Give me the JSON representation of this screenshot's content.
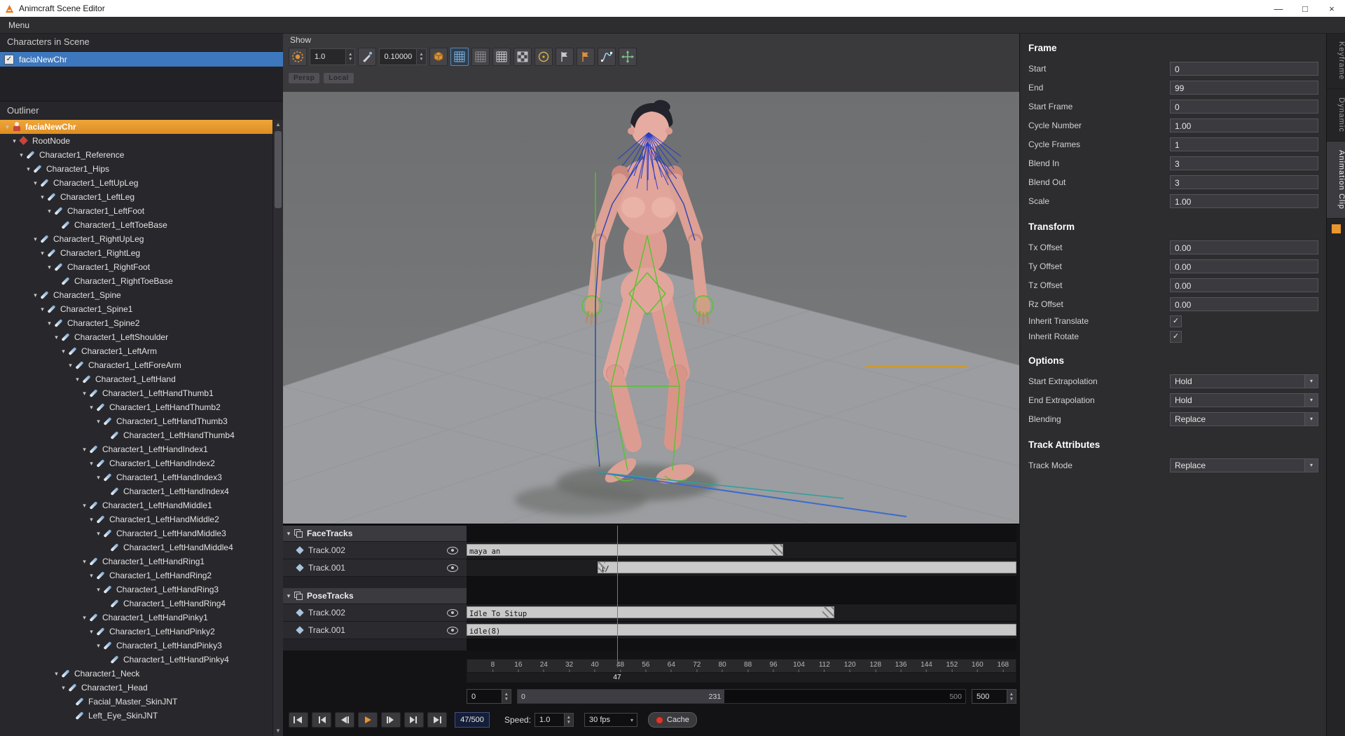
{
  "window": {
    "title": "Animcraft Scene Editor",
    "menu_label": "Menu"
  },
  "icons": {
    "caret_down": "▾",
    "spin_up": "▲",
    "spin_down": "▼",
    "check": "✓",
    "minimize": "—",
    "maximize": "□",
    "close": "×"
  },
  "colors": {
    "accent_orange": "#e8962e",
    "selection_blue": "#3d77bd",
    "selection_orange": "#f0a63a",
    "clip_fill": "#c9c9c9",
    "playhead_blue": "#5b79d8",
    "skin": "#e2a59b"
  },
  "left_panel": {
    "characters_header": "Characters in Scene",
    "characters": [
      {
        "label": "faciaNewChr",
        "checked": true
      }
    ],
    "outliner_header": "Outliner",
    "tree": [
      {
        "label": "faciaNewChr",
        "level": 0,
        "selected": true,
        "icon": "character"
      },
      {
        "label": "RootNode",
        "level": 1,
        "icon": "root"
      },
      {
        "label": "Character1_Reference",
        "level": 2
      },
      {
        "label": "Character1_Hips",
        "level": 3
      },
      {
        "label": "Character1_LeftUpLeg",
        "level": 4
      },
      {
        "label": "Character1_LeftLeg",
        "level": 5
      },
      {
        "label": "Character1_LeftFoot",
        "level": 6
      },
      {
        "label": "Character1_LeftToeBase",
        "level": 7,
        "leaf": true
      },
      {
        "label": "Character1_RightUpLeg",
        "level": 4
      },
      {
        "label": "Character1_RightLeg",
        "level": 5
      },
      {
        "label": "Character1_RightFoot",
        "level": 6
      },
      {
        "label": "Character1_RightToeBase",
        "level": 7,
        "leaf": true
      },
      {
        "label": "Character1_Spine",
        "level": 4
      },
      {
        "label": "Character1_Spine1",
        "level": 5
      },
      {
        "label": "Character1_Spine2",
        "level": 6
      },
      {
        "label": "Character1_LeftShoulder",
        "level": 7
      },
      {
        "label": "Character1_LeftArm",
        "level": 8
      },
      {
        "label": "Character1_LeftForeArm",
        "level": 9
      },
      {
        "label": "Character1_LeftHand",
        "level": 10
      },
      {
        "label": "Character1_LeftHandThumb1",
        "level": 11
      },
      {
        "label": "Character1_LeftHandThumb2",
        "level": 12
      },
      {
        "label": "Character1_LeftHandThumb3",
        "level": 13
      },
      {
        "label": "Character1_LeftHandThumb4",
        "level": 14,
        "leaf": true
      },
      {
        "label": "Character1_LeftHandIndex1",
        "level": 11
      },
      {
        "label": "Character1_LeftHandIndex2",
        "level": 12
      },
      {
        "label": "Character1_LeftHandIndex3",
        "level": 13
      },
      {
        "label": "Character1_LeftHandIndex4",
        "level": 14,
        "leaf": true
      },
      {
        "label": "Character1_LeftHandMiddle1",
        "level": 11
      },
      {
        "label": "Character1_LeftHandMiddle2",
        "level": 12
      },
      {
        "label": "Character1_LeftHandMiddle3",
        "level": 13
      },
      {
        "label": "Character1_LeftHandMiddle4",
        "level": 14,
        "leaf": true
      },
      {
        "label": "Character1_LeftHandRing1",
        "level": 11
      },
      {
        "label": "Character1_LeftHandRing2",
        "level": 12
      },
      {
        "label": "Character1_LeftHandRing3",
        "level": 13
      },
      {
        "label": "Character1_LeftHandRing4",
        "level": 14,
        "leaf": true
      },
      {
        "label": "Character1_LeftHandPinky1",
        "level": 11
      },
      {
        "label": "Character1_LeftHandPinky2",
        "level": 12
      },
      {
        "label": "Character1_LeftHandPinky3",
        "level": 13
      },
      {
        "label": "Character1_LeftHandPinky4",
        "level": 14,
        "leaf": true
      },
      {
        "label": "Character1_Neck",
        "level": 7
      },
      {
        "label": "Character1_Head",
        "level": 8
      },
      {
        "label": "Facial_Master_SkinJNT",
        "level": 9,
        "leaf": true
      },
      {
        "label": "Left_Eye_SkinJNT",
        "level": 9,
        "leaf": true
      }
    ]
  },
  "viewport": {
    "show_label": "Show",
    "persp_label": "Persp",
    "local_label": "Local",
    "toolbar": [
      {
        "type": "icon",
        "name": "shading-sphere-icon"
      },
      {
        "type": "spinner",
        "name": "weight-spinner",
        "value": "1.0"
      },
      {
        "type": "icon",
        "name": "brush-icon"
      },
      {
        "type": "spinner",
        "name": "size-spinner",
        "value": "0.10000"
      },
      {
        "type": "icon",
        "name": "cube-icon"
      },
      {
        "type": "icon",
        "name": "grid-blue-icon",
        "active": true
      },
      {
        "type": "icon",
        "name": "grid-icon"
      },
      {
        "type": "icon",
        "name": "grid-bright-icon"
      },
      {
        "type": "icon",
        "name": "grid-checker-icon"
      },
      {
        "type": "icon",
        "name": "circle-icon"
      },
      {
        "type": "icon",
        "name": "flag-icon"
      },
      {
        "type": "icon",
        "name": "flag-orange-icon"
      },
      {
        "type": "icon",
        "name": "curve-icon"
      },
      {
        "type": "icon",
        "name": "move-icon"
      }
    ]
  },
  "timeline": {
    "groups": [
      {
        "label": "FaceTracks",
        "tracks": [
          {
            "label": "Track.002"
          },
          {
            "label": "Track.001"
          }
        ],
        "lanes": [
          {
            "clips": [
              {
                "label": "maya_an",
                "start": 0,
                "end": 99,
                "hatch": "right"
              }
            ]
          },
          {
            "clips": [
              {
                "label": "1/",
                "start": 41,
                "end": 172,
                "hatch": "left"
              }
            ]
          }
        ]
      },
      {
        "label": "PoseTracks",
        "tracks": [
          {
            "label": "Track.002"
          },
          {
            "label": "Track.001"
          }
        ],
        "lanes": [
          {
            "clips": [
              {
                "label": "Idle To Situp",
                "start": 0,
                "end": 115,
                "hatch": "right"
              }
            ]
          },
          {
            "clips": [
              {
                "label": "idle(8)",
                "start": 0,
                "end": 172,
                "hatch": null
              }
            ]
          }
        ]
      }
    ],
    "ruler": {
      "start": 0,
      "end": 172,
      "ticks": [
        8,
        16,
        24,
        32,
        40,
        48,
        56,
        64,
        72,
        80,
        88,
        96,
        104,
        112,
        120,
        128,
        136,
        144,
        152,
        160,
        168
      ]
    },
    "playhead": {
      "frame": 47,
      "label": "47"
    },
    "range": {
      "left_spinner": "0",
      "window_start": "0",
      "window_end": "231",
      "total": "500",
      "right_spinner": "500"
    }
  },
  "transport": {
    "buttons": [
      {
        "name": "go-to-start-icon"
      },
      {
        "name": "previous-key-icon"
      },
      {
        "name": "play-backward-icon"
      },
      {
        "name": "play-icon",
        "accent": true
      },
      {
        "name": "step-forward-icon"
      },
      {
        "name": "next-key-icon"
      },
      {
        "name": "go-to-end-icon"
      }
    ],
    "frame_display": "47/500",
    "speed_label": "Speed:",
    "speed_value": "1.0",
    "fps_value": "30 fps",
    "cache_label": "Cache"
  },
  "right_panel": {
    "sections": [
      {
        "title": "Frame",
        "rows": [
          {
            "label": "Start",
            "type": "input",
            "value": "0"
          },
          {
            "label": "End",
            "type": "input",
            "value": "99"
          },
          {
            "label": "Start Frame",
            "type": "input",
            "value": "0"
          },
          {
            "label": "Cycle Number",
            "type": "input",
            "value": "1.00"
          },
          {
            "label": "Cycle Frames",
            "type": "input",
            "value": "1"
          },
          {
            "label": "Blend In",
            "type": "input",
            "value": "3"
          },
          {
            "label": "Blend Out",
            "type": "input",
            "value": "3"
          },
          {
            "label": "Scale",
            "type": "input",
            "value": "1.00"
          }
        ]
      },
      {
        "title": "Transform",
        "rows": [
          {
            "label": "Tx Offset",
            "type": "input",
            "value": "0.00"
          },
          {
            "label": "Ty Offset",
            "type": "input",
            "value": "0.00"
          },
          {
            "label": "Tz Offset",
            "type": "input",
            "value": "0.00"
          },
          {
            "label": "Rz Offset",
            "type": "input",
            "value": "0.00"
          },
          {
            "label": "Inherit Translate",
            "type": "checkbox",
            "value": true
          },
          {
            "label": "Inherit Rotate",
            "type": "checkbox",
            "value": true
          }
        ]
      },
      {
        "title": "Options",
        "rows": [
          {
            "label": "Start Extrapolation",
            "type": "select",
            "value": "Hold"
          },
          {
            "label": "End Extrapolation",
            "type": "select",
            "value": "Hold"
          },
          {
            "label": "Blending",
            "type": "select",
            "value": "Replace"
          }
        ]
      },
      {
        "title": "Track Attributes",
        "rows": [
          {
            "label": "Track Mode",
            "type": "select",
            "value": "Replace"
          }
        ]
      }
    ]
  },
  "side_tabs": [
    {
      "label": "Keyframe",
      "selected": false
    },
    {
      "label": "Dynamic",
      "selected": false
    },
    {
      "label": "Animation Clip",
      "selected": true
    }
  ]
}
